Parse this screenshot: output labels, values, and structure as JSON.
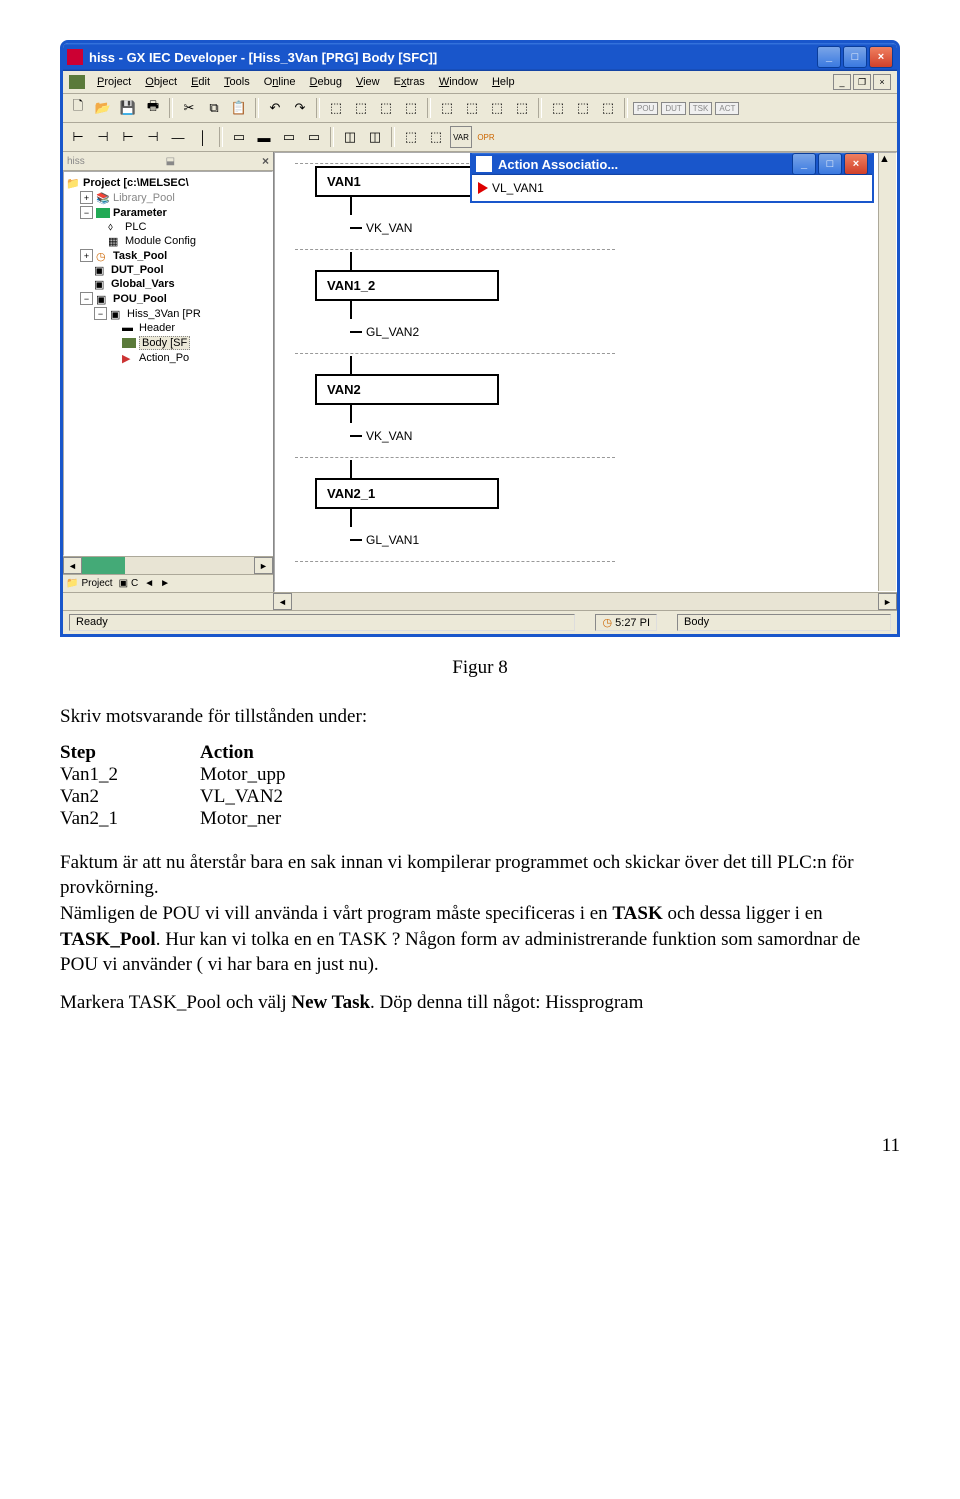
{
  "window": {
    "title": "hiss - GX IEC Developer - [Hiss_3Van [PRG] Body [SFC]]",
    "minimize": "_",
    "maximize": "□",
    "close": "×"
  },
  "menu": {
    "items": [
      "Project",
      "Object",
      "Edit",
      "Tools",
      "Online",
      "Debug",
      "View",
      "Extras",
      "Window",
      "Help"
    ]
  },
  "toolbar_tags": [
    "POU",
    "DUT",
    "TSK",
    "ACT"
  ],
  "sidebar": {
    "header": "hiss",
    "close": "×",
    "tabs": {
      "project": "Project",
      "c": "C"
    }
  },
  "tree": {
    "root": "Project [c:\\MELSEC\\",
    "n1": "Library_Pool",
    "n2": "Parameter",
    "n2a": "PLC",
    "n2b": "Module Config",
    "n3": "Task_Pool",
    "n4": "DUT_Pool",
    "n5": "Global_Vars",
    "n6": "POU_Pool",
    "n6a": "Hiss_3Van [PR",
    "n6a1": "Header",
    "n6a2": "Body [SF",
    "n6a3": "Action_Po"
  },
  "sfc": {
    "s1": "VAN1",
    "t1": "VK_VAN",
    "s2": "VAN1_2",
    "t2": "GL_VAN2",
    "s3": "VAN2",
    "t3": "VK_VAN",
    "s4": "VAN2_1",
    "t4": "GL_VAN1"
  },
  "action_assoc": {
    "title": "Action Associatio...",
    "item": "VL_VAN1"
  },
  "status": {
    "ready": "Ready",
    "time": "5:27 PI",
    "mode": "Body"
  },
  "doc": {
    "figcap": "Figur 8",
    "p1": "Skriv motsvarande för tillstånden under:",
    "th1": "Step",
    "th2": "Action",
    "r1c1": "Van1_2",
    "r1c2": "Motor_upp",
    "r2c1": "Van2",
    "r2c2": "VL_VAN2",
    "r3c1": "Van2_1",
    "r3c2": "Motor_ner",
    "p2a": "Faktum är att nu återstår bara en sak innan vi kompilerar programmet och skickar över det till PLC:n för provkörning.",
    "p2b": "Nämligen de POU vi vill använda i vårt program måste specificeras i en ",
    "p2c": "TASK",
    "p2d": " och dessa ligger i en ",
    "p2e": "TASK_Pool",
    "p2f": ". Hur kan vi tolka en en TASK ? Någon form av administrerande funktion som samordnar de POU vi använder ( vi har bara en just nu).",
    "p3a": "Markera TASK_Pool och välj ",
    "p3b": "New Task",
    "p3c": ". Döp denna till något: Hissprogram",
    "pagenum": "11"
  }
}
